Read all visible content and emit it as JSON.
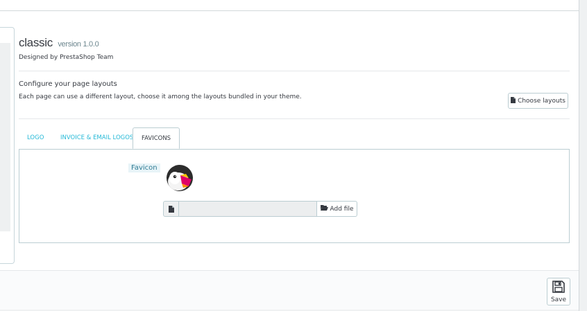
{
  "theme": {
    "name": "classic",
    "version": "version 1.0.0",
    "designed_by": "Designed by PrestaShop Team"
  },
  "layouts": {
    "title": "Configure your page layouts",
    "description": "Each page can use a different layout, choose it among the layouts bundled in your theme.",
    "choose_button": "Choose layouts",
    "choose_icon": "file-icon"
  },
  "tabs": [
    {
      "label": "LOGO",
      "active": false
    },
    {
      "label": "INVOICE & EMAIL LOGOS",
      "active": false
    },
    {
      "label": "FAVICONS",
      "active": true
    }
  ],
  "favicon": {
    "label": "Favicon",
    "image_icon": "prestashop-puffin-logo",
    "file_value": "",
    "file_icon": "file-icon",
    "add_button": "Add file",
    "add_icon": "folder-open-icon"
  },
  "footer": {
    "save_label": "Save",
    "save_icon": "floppy-disk-icon"
  },
  "colors": {
    "accent": "#25b9d7",
    "text": "#363a41",
    "border": "#bbcdd2"
  }
}
